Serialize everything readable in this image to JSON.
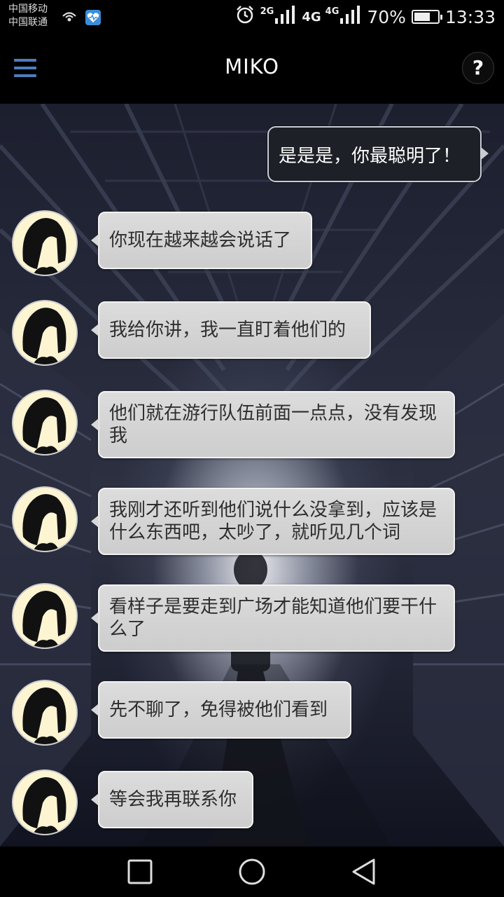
{
  "status_bar": {
    "carrier_1": "中国移动",
    "carrier_2": "中国联通",
    "net_2g": "2G",
    "net_4g": "4G",
    "net_4g_small": "4G",
    "battery_percent": "70%",
    "battery_level": 0.7,
    "time": "13:33"
  },
  "header": {
    "title": "MIKO",
    "help_label": "?"
  },
  "messages": [
    {
      "side": "out",
      "text": "是是是，你最聪明了！"
    },
    {
      "side": "in",
      "text": "你现在越来越会说话了"
    },
    {
      "side": "in",
      "text": "我给你讲，我一直盯着他们的"
    },
    {
      "side": "in",
      "text": "他们就在游行队伍前面一点点，没有发现我"
    },
    {
      "side": "in",
      "text": "我刚才还听到他们说什么没拿到，应该是什么东西吧，太吵了，就听见几个词"
    },
    {
      "side": "in",
      "text": "看样子是要走到广场才能知道他们要干什么了"
    },
    {
      "side": "in",
      "text": "先不聊了，免得被他们看到"
    },
    {
      "side": "in",
      "text": "等会我再联系你"
    }
  ],
  "colors": {
    "menu_accent": "#4b7fbf",
    "incoming_bubble": "#d6d6d6",
    "outgoing_bubble": "#1d2026",
    "avatar_bg": "#fdf5d2"
  },
  "icons": {
    "menu": "hamburger-menu-icon",
    "help": "question-mark-icon",
    "alarm": "alarm-clock-icon",
    "back": "back-triangle-icon",
    "home": "home-circle-icon",
    "recents": "recents-square-icon"
  }
}
